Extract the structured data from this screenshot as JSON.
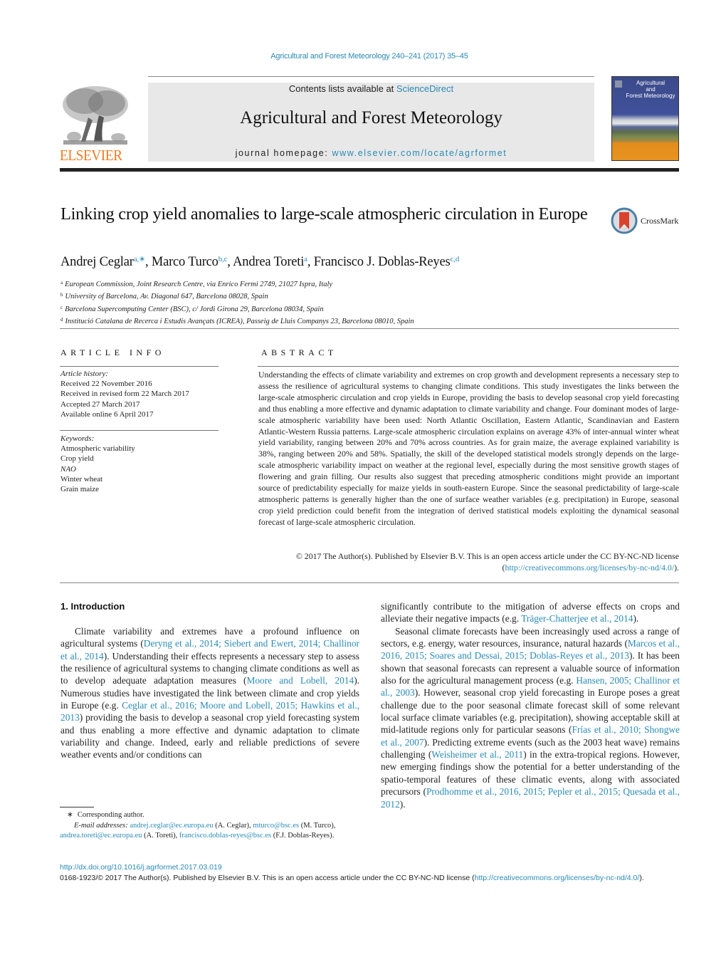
{
  "header": {
    "journal_ref": "Agricultural and Forest Meteorology 240–241 (2017) 35–45",
    "contents_prefix": "Contents lists available at ",
    "contents_link": "ScienceDirect",
    "journal_title": "Agricultural and Forest Meteorology",
    "homepage_prefix": "journal homepage: ",
    "homepage_link": "www.elsevier.com/locate/agrformet",
    "publisher_logo_text": "ELSEVIER",
    "cover_title": "Agricultural and Forest Meteorology",
    "cover_title_lines": [
      "Agricultural",
      "and",
      "Forest Meteorology"
    ]
  },
  "article": {
    "title": "Linking crop yield anomalies to large-scale atmospheric circulation in Europe",
    "crossmark_label": "CrossMark",
    "authors": [
      {
        "name": "Andrej Ceglar",
        "sup": "a,∗"
      },
      {
        "name": "Marco Turco",
        "sup": "b,c"
      },
      {
        "name": "Andrea Toreti",
        "sup": "a"
      },
      {
        "name": "Francisco J. Doblas-Reyes",
        "sup": "c,d"
      }
    ],
    "affiliations": [
      {
        "key": "a",
        "text": "European Commission, Joint Research Centre, via Enrico Fermi 2749, 21027 Ispra, Italy"
      },
      {
        "key": "b",
        "text": "University of Barcelona, Av. Diagonal 647, Barcelona 08028, Spain"
      },
      {
        "key": "c",
        "text": "Barcelona Supercomputing Center (BSC), c/ Jordi Girona 29, Barcelona 08034, Spain"
      },
      {
        "key": "d",
        "text": "Institució Catalana de Recerca i Estudis Avançats (ICREA), Passeig de Lluis Companys 23, Barcelona 08010, Spain"
      }
    ]
  },
  "article_info": {
    "heading": "ARTICLE INFO",
    "history_label": "Article history:",
    "history": [
      "Received 22 November 2016",
      "Received in revised form 22 March 2017",
      "Accepted 27 March 2017",
      "Available online 6 April 2017"
    ],
    "keywords_label": "Keywords:",
    "keywords": [
      "Atmospheric variability",
      "Crop yield",
      "NAO",
      "Winter wheat",
      "Grain maize"
    ]
  },
  "abstract": {
    "heading": "ABSTRACT",
    "text": "Understanding the effects of climate variability and extremes on crop growth and development represents a necessary step to assess the resilience of agricultural systems to changing climate conditions. This study investigates the links between the large-scale atmospheric circulation and crop yields in Europe, providing the basis to develop seasonal crop yield forecasting and thus enabling a more effective and dynamic adaptation to climate variability and change. Four dominant modes of large-scale atmospheric variability have been used: North Atlantic Oscillation, Eastern Atlantic, Scandinavian and Eastern Atlantic-Western Russia patterns. Large-scale atmospheric circulation explains on average 43% of inter-annual winter wheat yield variability, ranging between 20% and 70% across countries. As for grain maize, the average explained variability is 38%, ranging between 20% and 58%. Spatially, the skill of the developed statistical models strongly depends on the large-scale atmospheric variability impact on weather at the regional level, especially during the most sensitive growth stages of flowering and grain filling. Our results also suggest that preceding atmospheric conditions might provide an important source of predictability especially for maize yields in south-eastern Europe. Since the seasonal predictability of large-scale atmospheric patterns is generally higher than the one of surface weather variables (e.g. precipitation) in Europe, seasonal crop yield prediction could benefit from the integration of derived statistical models exploiting the dynamical seasonal forecast of large-scale atmospheric circulation.",
    "license_prefix": "© 2017 The Author(s). Published by Elsevier B.V. This is an open access article under the CC BY-NC-ND license (",
    "license_link": "http://creativecommons.org/licenses/by-nc-nd/4.0/",
    "license_suffix": ")."
  },
  "introduction": {
    "heading": "1.  Introduction",
    "p1": [
      {
        "t": "Climate variability and extremes have a profound influence on agricultural systems ("
      },
      {
        "l": "Deryng et al., 2014; Siebert and Ewert, 2014; Challinor et al., 2014"
      },
      {
        "t": "). Understanding their effects represents a necessary step to assess the resilience of agricultural systems to changing climate conditions as well as to develop adequate adaptation measures ("
      },
      {
        "l": "Moore and Lobell, 2014"
      },
      {
        "t": "). Numerous studies have investigated the link between climate and crop yields in Europe (e.g. "
      },
      {
        "l": "Ceglar et al., 2016; Moore and Lobell, 2015; Hawkins et al., 2013"
      },
      {
        "t": ") providing the basis to develop a seasonal crop yield forecasting system and thus enabling a more effective and dynamic adaptation to climate variability and change. Indeed, early and reliable predictions of severe weather events and/or conditions can significantly contribute to the mitigation of adverse effects on crops and alleviate their negative impacts (e.g. "
      },
      {
        "l": "Träger-Chatterjee et al., 2014"
      },
      {
        "t": ")."
      }
    ],
    "p2": [
      {
        "t": "Seasonal climate forecasts have been increasingly used across a range of sectors, e.g. energy, water resources, insurance, natural hazards ("
      },
      {
        "l": "Marcos et al., 2016, 2015; Soares and Dessai, 2015; Doblas-Reyes et al., 2013"
      },
      {
        "t": "). It has been shown that seasonal forecasts can represent a valuable source of information also for the agricultural management process (e.g. "
      },
      {
        "l": "Hansen, 2005; Challinor et al., 2003"
      },
      {
        "t": "). However, seasonal crop yield forecasting in Europe poses a great challenge due to the poor seasonal climate forecast skill of some relevant local surface climate variables (e.g. precipitation), showing acceptable skill at mid-latitude regions only for particular seasons ("
      },
      {
        "l": "Frías et al., 2010; Shongwe et al., 2007"
      },
      {
        "t": "). Predicting extreme events (such as the 2003 heat wave) remains challenging ("
      },
      {
        "l": "Weisheimer et al., 2011"
      },
      {
        "t": ") in the extra-tropical regions. However, new emerging findings show the potential for a better understanding of the spatio-temporal features of these climatic events, along with associated precursors ("
      },
      {
        "l": "Prodhomme et al., 2016, 2015; Pepler et al., 2015; Quesada et al., 2012"
      },
      {
        "t": ")."
      }
    ]
  },
  "footnotes": {
    "star": "∗",
    "corresponding": "Corresponding author.",
    "email_label": "E-mail addresses:",
    "emails": [
      {
        "addr": "andrej.ceglar@ec.europa.eu",
        "who": " (A. Ceglar), "
      },
      {
        "addr": "mturco@bsc.es",
        "who": " (M. Turco), "
      },
      {
        "addr": "andrea.toreti@ec.europa.eu",
        "who": " (A. Toreti), "
      },
      {
        "addr": "francisco.doblas-reyes@bsc.es",
        "who": " (F.J. Doblas-Reyes)."
      }
    ]
  },
  "footer": {
    "doi": "http://dx.doi.org/10.1016/j.agrformet.2017.03.019",
    "issn_prefix": "0168-1923/© 2017 The Author(s). Published by Elsevier B.V. This is an open access article under the CC BY-NC-ND license (",
    "issn_link": "http://creativecommons.org/licenses/by-nc-nd/4.0/",
    "issn_suffix": ")."
  },
  "colors": {
    "link": "#2a8ab5",
    "elsevier_orange": "#f07b1f",
    "header_box": "#e8e8e8"
  }
}
